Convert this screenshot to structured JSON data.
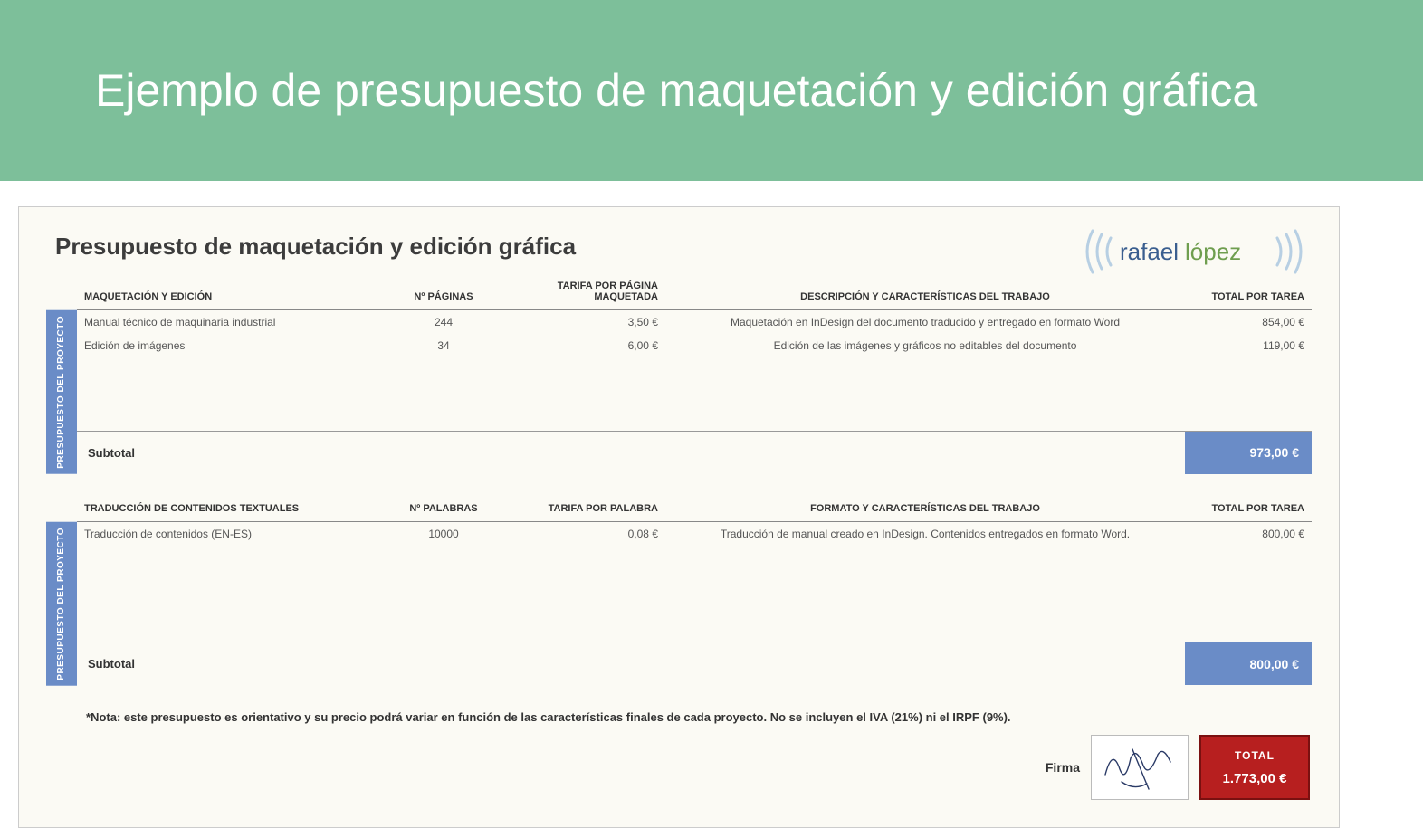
{
  "banner": {
    "title": "Ejemplo de presupuesto de maquetación y edición gráfica"
  },
  "logo": {
    "brand_text": "rafaellópez",
    "brand_colors": {
      "ring": "#7fa8cc",
      "word1": "#3a5e8f",
      "word2": "#6f9e4f"
    }
  },
  "doc": {
    "title": "Presupuesto de maquetación y edición gráfica",
    "side_label": "PRESUPUESTO\nDEL PROYECTO"
  },
  "section1": {
    "headers": {
      "concept": "MAQUETACIÓN Y EDICIÓN",
      "qty": "Nº PÁGINAS",
      "rate": "TARIFA POR PÁGINA MAQUETADA",
      "features": "DESCRIPCIÓN Y CARACTERÍSTICAS DEL TRABAJO",
      "total": "TOTAL POR TAREA"
    },
    "rows": [
      {
        "concept": "Manual técnico de maquinaria industrial",
        "qty": "244",
        "rate": "3,50 €",
        "features": "Maquetación en InDesign del documento traducido y entregado en formato Word",
        "total": "854,00 €"
      },
      {
        "concept": "Edición de imágenes",
        "qty": "34",
        "rate": "6,00 €",
        "features": "Edición de las imágenes y gráficos no editables del documento",
        "total": "119,00 €"
      }
    ],
    "subtotal_label": "Subtotal",
    "subtotal_value": "973,00 €"
  },
  "section2": {
    "headers": {
      "concept": "TRADUCCIÓN DE CONTENIDOS TEXTUALES",
      "qty": "Nº PALABRAS",
      "rate": "TARIFA POR PALABRA",
      "features": "FORMATO Y CARACTERÍSTICAS DEL TRABAJO",
      "total": "TOTAL POR TAREA"
    },
    "rows": [
      {
        "concept": "Traducción de contenidos (EN-ES)",
        "qty": "10000",
        "rate": "0,08 €",
        "features": "Traducción de manual creado en InDesign. Contenidos entregados en formato Word.",
        "total": "800,00 €"
      }
    ],
    "subtotal_label": "Subtotal",
    "subtotal_value": "800,00 €"
  },
  "note": "*Nota: este presupuesto es orientativo y su precio podrá variar en función de las características finales de cada proyecto. No se incluyen el IVA (21%) ni el IRPF (9%).",
  "footer": {
    "firma": "Firma",
    "total_label": "TOTAL",
    "total_value": "1.773,00 €"
  }
}
